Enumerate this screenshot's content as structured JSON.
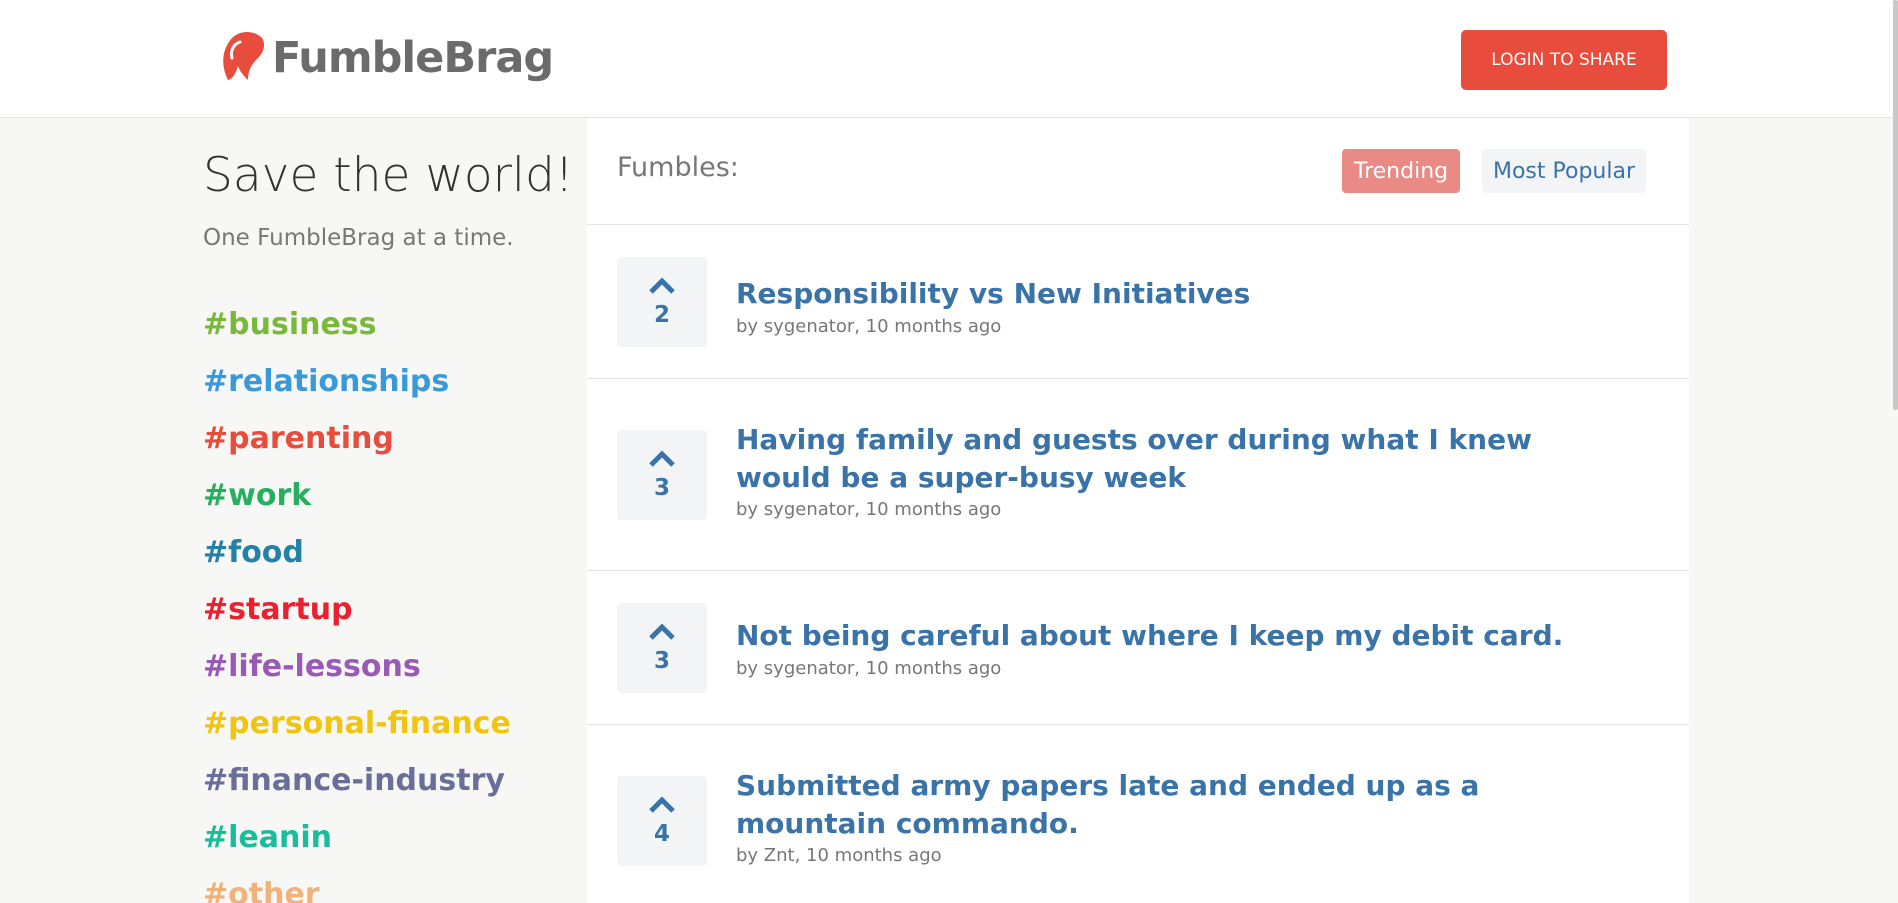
{
  "brand": {
    "name": "FumbleBrag",
    "login_label": "LOGIN TO SHARE",
    "accent": "#e84c3d"
  },
  "sidebar": {
    "title": "Save the world!",
    "subtitle": "One FumbleBrag at a time.",
    "tags": [
      {
        "label": "#business",
        "color": "#7ab83c"
      },
      {
        "label": "#relationships",
        "color": "#3a9ad9"
      },
      {
        "label": "#parenting",
        "color": "#e84c3d"
      },
      {
        "label": "#work",
        "color": "#27ae60"
      },
      {
        "label": "#food",
        "color": "#2380a6"
      },
      {
        "label": "#startup",
        "color": "#e8202f"
      },
      {
        "label": "#life-lessons",
        "color": "#9b59b6"
      },
      {
        "label": "#personal-finance",
        "color": "#f1c40f"
      },
      {
        "label": "#finance-industry",
        "color": "#6a6f9a"
      },
      {
        "label": "#leanin",
        "color": "#1abc9c"
      },
      {
        "label": "#other",
        "color": "#f0b27a"
      }
    ]
  },
  "main": {
    "heading": "Fumbles:",
    "tabs": [
      {
        "label": "Trending",
        "active": true
      },
      {
        "label": "Most Popular",
        "active": false
      }
    ],
    "posts": [
      {
        "title": "Responsibility vs New Initiatives",
        "meta": "by sygenator, 10 months ago",
        "votes": "2"
      },
      {
        "title": "Having family and guests over during what I knew would be a super-busy week",
        "meta": "by sygenator, 10 months ago",
        "votes": "3"
      },
      {
        "title": "Not being careful about where I keep my debit card.",
        "meta": "by sygenator, 10 months ago",
        "votes": "3"
      },
      {
        "title": "Submitted army papers late and ended up as a mountain commando.",
        "meta": "by Znt, 10 months ago",
        "votes": "4"
      }
    ]
  },
  "icons": {
    "upvote": "chevron-up-icon",
    "logo": "logo-icon"
  }
}
